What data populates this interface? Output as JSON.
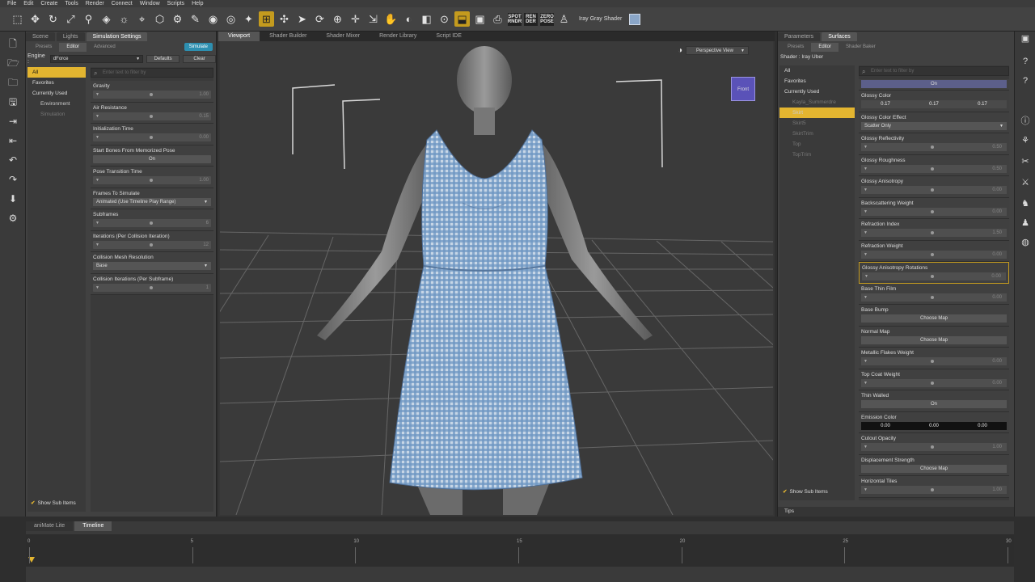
{
  "menu": [
    "File",
    "Edit",
    "Create",
    "Tools",
    "Render",
    "Connect",
    "Window",
    "Scripts",
    "Help"
  ],
  "toolbar": {
    "shader_label": "Iray Gray Shader",
    "icons": [
      "select-icon",
      "move-icon",
      "rotate-icon",
      "scale-icon",
      "joint-icon",
      "node-icon",
      "light-icon",
      "camera-icon",
      "geometry-icon",
      "morph-icon",
      "render-icon",
      "render-settings-icon",
      "iray-icon"
    ]
  },
  "left_panel": {
    "tabs": [
      "Scene",
      "Lights",
      "Simulation Settings"
    ],
    "subtabs": [
      "Presets",
      "Editor",
      "Advanced"
    ],
    "simulate_label": "Simulate",
    "engine_label": "Engine :",
    "engine_value": "dForce",
    "defaults_label": "Defaults",
    "clear_label": "Clear",
    "search_placeholder": "Enter text to filter by",
    "filters": [
      {
        "label": "All",
        "sel": true
      },
      {
        "label": "Favorites"
      },
      {
        "label": "Currently Used"
      },
      {
        "label": "Environment",
        "sub": true
      },
      {
        "label": "Simulation",
        "sub": true,
        "dim": true
      }
    ],
    "show_sub_items": "Show Sub Items",
    "properties": [
      {
        "label": "Gravity",
        "type": "slider",
        "value": "1.00"
      },
      {
        "label": "Air Resistance",
        "type": "slider",
        "value": "0.15"
      },
      {
        "label": "Initialization Time",
        "type": "slider",
        "value": "0.00"
      },
      {
        "label": "Start Bones From Memorized Pose",
        "type": "button",
        "value": "On"
      },
      {
        "label": "Pose Transition Time",
        "type": "slider",
        "value": "1.00"
      },
      {
        "label": "Frames To Simulate",
        "type": "dropdown",
        "value": "Animated (Use Timeline Play Range)"
      },
      {
        "label": "Subframes",
        "type": "slider",
        "value": "6"
      },
      {
        "label": "Iterations (Per Collision Iteration)",
        "type": "slider",
        "value": "12"
      },
      {
        "label": "Collision Mesh Resolution",
        "type": "dropdown",
        "value": "Base"
      },
      {
        "label": "Collision Iterations (Per Subframe)",
        "type": "slider",
        "value": "1"
      }
    ]
  },
  "viewport": {
    "tabs": [
      "Viewport",
      "Shader Builder",
      "Shader Mixer",
      "Render Library",
      "Script IDE"
    ],
    "perspective_label": "Perspective View",
    "cube_label": "Front"
  },
  "right_panel": {
    "tabs": [
      "Parameters",
      "Surfaces"
    ],
    "subtabs": [
      "Presets",
      "Editor",
      "Shader Baker"
    ],
    "shader_label": "Shader : Iray Uber",
    "search_placeholder": "Enter text to filter by",
    "filters": [
      {
        "label": "All"
      },
      {
        "label": "Favorites"
      },
      {
        "label": "Currently Used"
      },
      {
        "label": "Kayla_Summerdre",
        "sub": true,
        "dim": true
      },
      {
        "label": "Skirt",
        "sub": true,
        "sel": true
      },
      {
        "label": "Skirt5",
        "sub": true,
        "dim": true
      },
      {
        "label": "SkirtTrim",
        "sub": true,
        "dim": true
      },
      {
        "label": "Top",
        "sub": true,
        "dim": true
      },
      {
        "label": "TopTrim",
        "sub": true,
        "dim": true
      }
    ],
    "top_toggle": "On",
    "show_sub_items": "Show Sub Items",
    "tips_label": "Tips",
    "properties": [
      {
        "label": "Glossy Color",
        "type": "trio",
        "values": [
          "0.17",
          "0.17",
          "0.17"
        ]
      },
      {
        "label": "Glossy Color Effect",
        "type": "dropdown",
        "value": "Scatter Only"
      },
      {
        "label": "Glossy Reflectivity",
        "type": "slider",
        "value": "0.50"
      },
      {
        "label": "Glossy Roughness",
        "type": "slider",
        "value": "0.50"
      },
      {
        "label": "Glossy Anisotropy",
        "type": "slider",
        "value": "0.00"
      },
      {
        "label": "Backscattering Weight",
        "type": "slider",
        "value": "0.00"
      },
      {
        "label": "Refraction Index",
        "type": "slider",
        "value": "1.50"
      },
      {
        "label": "Refraction Weight",
        "type": "slider",
        "value": "0.00"
      },
      {
        "label": "Glossy Anisotropy Rotations",
        "type": "slider",
        "value": "0.00",
        "hl": true
      },
      {
        "label": "Base Thin Film",
        "type": "slider",
        "value": "0.00"
      },
      {
        "label": "Base Bump",
        "type": "button",
        "value": "Choose Map"
      },
      {
        "label": "Normal Map",
        "type": "button",
        "value": "Choose Map"
      },
      {
        "label": "Metallic Flakes Weight",
        "type": "slider",
        "value": "0.00"
      },
      {
        "label": "Top Coat Weight",
        "type": "slider",
        "value": "0.00"
      },
      {
        "label": "Thin Walled",
        "type": "button",
        "value": "On"
      },
      {
        "label": "Emission Color",
        "type": "trio",
        "dark": true,
        "values": [
          "0.00",
          "0.00",
          "0.00"
        ]
      },
      {
        "label": "Cutout Opacity",
        "type": "slider",
        "value": "1.00"
      },
      {
        "label": "Displacement Strength",
        "type": "button",
        "value": "Choose Map"
      },
      {
        "label": "Horizontal Tiles",
        "type": "slider",
        "value": "1.00"
      }
    ]
  },
  "timeline": {
    "tabs": [
      "aniMate Lite",
      "Timeline"
    ],
    "ticks": [
      "0",
      "5",
      "10",
      "15",
      "20",
      "25",
      "30"
    ],
    "end_label": "30"
  }
}
